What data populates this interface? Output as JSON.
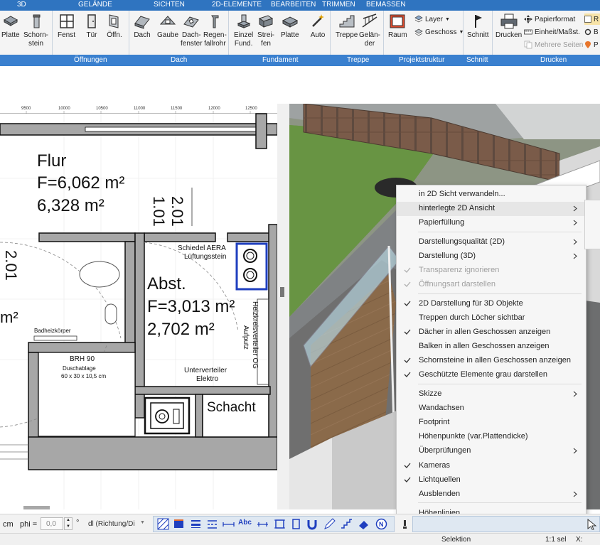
{
  "ribbon": {
    "tabs": [
      "3D",
      "GELÄNDE",
      "SICHTEN",
      "2D-ELEMENTE",
      "BEARBEITEN",
      "TRIMMEN",
      "BEMASSEN"
    ],
    "buttons": {
      "platte": "Platte",
      "schornstein": "Schorn-\nstein",
      "fenster": "Fenst",
      "tuer": "Tür",
      "oeffnung": "Öffn.",
      "dach": "Dach",
      "gaube": "Gaube",
      "dachfenster": "Dach-\nfenster",
      "regenfallrohr": "Regen-\nfallrohr",
      "einzelfund": "Einzel\nFund.",
      "streifen": "Strei-\nfen",
      "platte2": "Platte",
      "auto": "Auto",
      "treppe": "Treppe",
      "gelaender": "Gelän-\nder",
      "raum": "Raum",
      "layer": "Layer",
      "geschoss": "Geschoss",
      "schnitt": "Schnitt",
      "drucken": "Drucken",
      "papierformat": "Papierformat",
      "einheit": "Einheit/Maßst.",
      "mehrere_seiten": "Mehrere Seiten",
      "r": "R",
      "b": "B",
      "p": "P"
    },
    "groups": [
      "Öffnungen",
      "Dach",
      "Fundament",
      "Treppe",
      "Projektstruktur",
      "Schnitt",
      "Drucken"
    ]
  },
  "plan": {
    "ruler": [
      "9500",
      "10000",
      "10500",
      "11000",
      "11500",
      "12000",
      "12500"
    ],
    "flur": {
      "name": "Flur",
      "area": "F=6,062 m²",
      "area2": "6,328 m²"
    },
    "abst": {
      "name": "Abst.",
      "area": "F=3,013 m²",
      "area2": "2,702 m²"
    },
    "dim_a": "1.01",
    "dim_b": "2.01",
    "dim_c": "2.01",
    "partial_area": "m²",
    "schiedel": "Schiedel AERA",
    "lueftung": "Lüftungsstein",
    "heizkreis": "Heizkreisverteiler OG",
    "aufputz": "Aufputz",
    "badheiz": "Badheizkörper",
    "brh": "BRH 90",
    "duschablage": "Duschablage",
    "duschmass": "60 x 30 x 10,5 cm",
    "unterverteiler": "Unterverteiler",
    "elektro": "Elektro",
    "schacht": "Schacht"
  },
  "menu": {
    "items": [
      {
        "label": "in 2D Sicht verwandeln...",
        "checked": false,
        "submenu": false,
        "disabled": false
      },
      {
        "label": "hinterlegte 2D Ansicht",
        "checked": false,
        "submenu": true,
        "disabled": false
      },
      {
        "label": "Papierfüllung",
        "checked": false,
        "submenu": true,
        "disabled": false
      },
      {
        "label": "Darstellungsqualität (2D)",
        "checked": false,
        "submenu": true,
        "disabled": false
      },
      {
        "label": "Darstellung (3D)",
        "checked": false,
        "submenu": true,
        "disabled": false
      },
      {
        "label": "Transparenz ignorieren",
        "checked": true,
        "submenu": false,
        "disabled": true
      },
      {
        "label": "Öffnungsart darstellen",
        "checked": true,
        "submenu": false,
        "disabled": true
      },
      {
        "label": "2D Darstellung für 3D Objekte",
        "checked": true,
        "submenu": false,
        "disabled": false
      },
      {
        "label": "Treppen durch Löcher sichtbar",
        "checked": false,
        "submenu": false,
        "disabled": false
      },
      {
        "label": "Dächer in allen Geschossen anzeigen",
        "checked": true,
        "submenu": false,
        "disabled": false
      },
      {
        "label": "Balken in allen Geschossen anzeigen",
        "checked": false,
        "submenu": false,
        "disabled": false
      },
      {
        "label": "Schornsteine in allen Geschossen anzeigen",
        "checked": true,
        "submenu": false,
        "disabled": false
      },
      {
        "label": "Geschützte Elemente grau darstellen",
        "checked": true,
        "submenu": false,
        "disabled": false
      },
      {
        "label": "Skizze",
        "checked": false,
        "submenu": true,
        "disabled": false
      },
      {
        "label": "Wandachsen",
        "checked": false,
        "submenu": false,
        "disabled": false
      },
      {
        "label": "Footprint",
        "checked": false,
        "submenu": false,
        "disabled": false
      },
      {
        "label": "Höhenpunkte (var.Plattendicke)",
        "checked": false,
        "submenu": false,
        "disabled": false
      },
      {
        "label": "Überprüfungen",
        "checked": false,
        "submenu": true,
        "disabled": false
      },
      {
        "label": "Kameras",
        "checked": true,
        "submenu": false,
        "disabled": false
      },
      {
        "label": "Lichtquellen",
        "checked": true,
        "submenu": false,
        "disabled": false
      },
      {
        "label": "Ausblenden",
        "checked": false,
        "submenu": true,
        "disabled": false
      },
      {
        "label": "Höhenlinien",
        "checked": false,
        "submenu": false,
        "disabled": false
      }
    ]
  },
  "bottom": {
    "unit": "cm",
    "phi_label": "phi =",
    "phi_value": "0,0",
    "deg": "°",
    "dl_value": "dl (Richtung/Di",
    "abc": "Abc"
  },
  "status": {
    "mode": "Selektion",
    "scale": "1:1 sel",
    "x": "X:"
  },
  "colors": {
    "tabbar": "#2f74c0",
    "groupbar": "#3a80cf",
    "accent_blue": "#1f3fbf"
  }
}
